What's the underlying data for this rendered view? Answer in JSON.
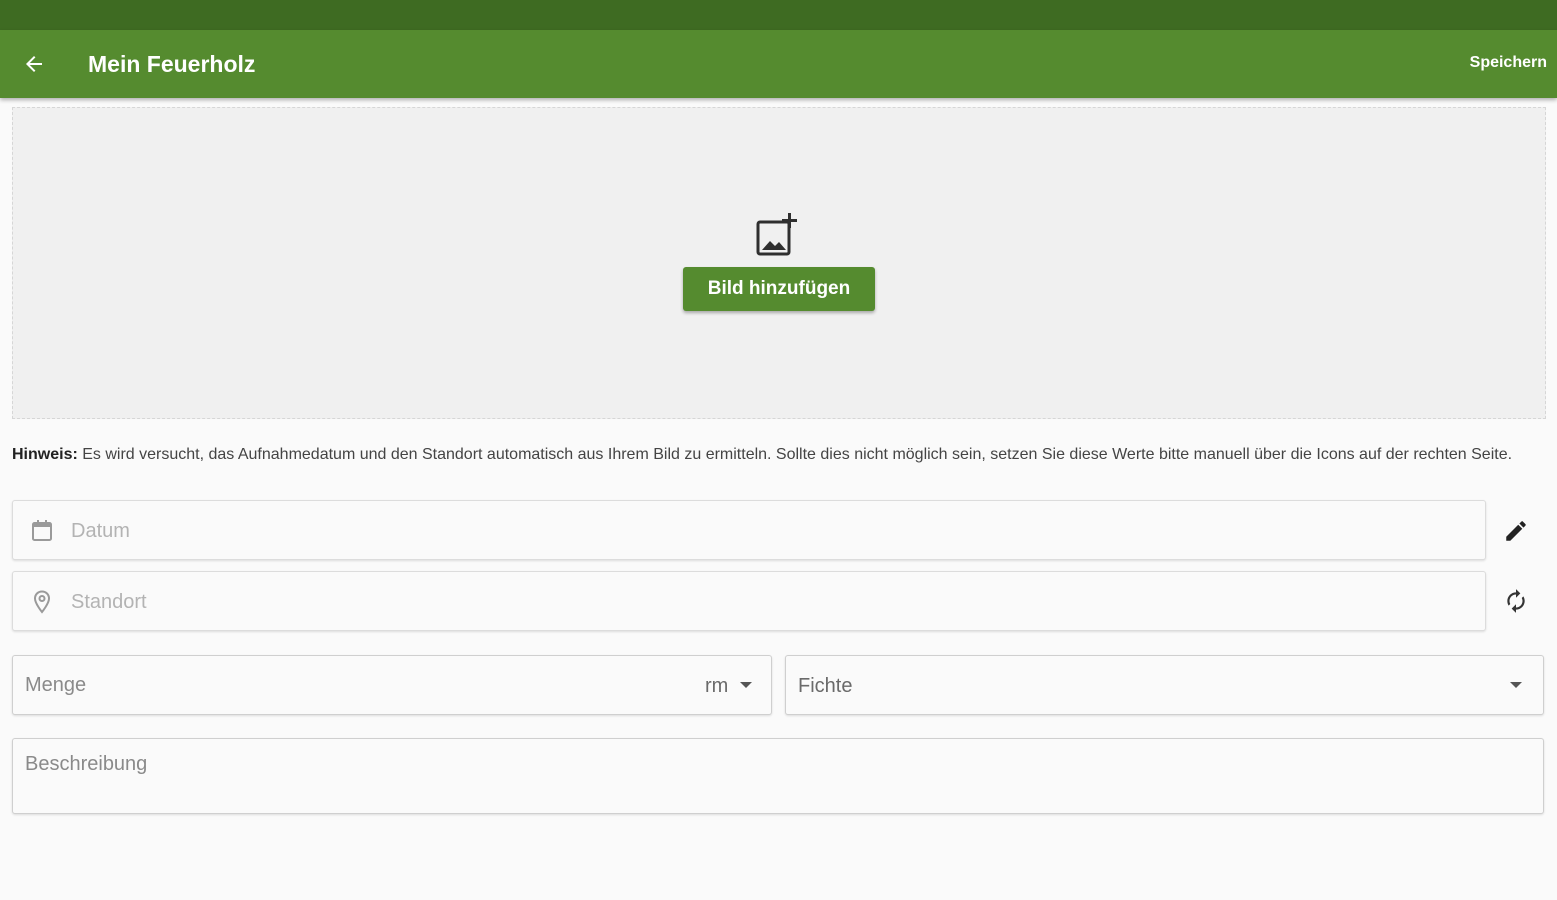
{
  "header": {
    "title": "Mein Feuerholz",
    "save_label": "Speichern"
  },
  "image_upload": {
    "button_label": "Bild hinzufügen",
    "icon": "add-photo-icon"
  },
  "hint": {
    "label": "Hinweis:",
    "text": " Es wird versucht, das Aufnahmedatum und den Standort automatisch aus Ihrem Bild zu ermitteln. Sollte dies nicht möglich sein, setzen Sie diese Werte bitte manuell über die Icons auf der rechten Seite."
  },
  "fields": {
    "date_placeholder": "Datum",
    "location_placeholder": "Standort",
    "amount_label": "Menge",
    "unit_value": "rm",
    "wood_type_value": "Fichte",
    "description_label": "Beschreibung"
  },
  "colors": {
    "primary": "#558b2f",
    "primary_dark": "#3e6b22"
  }
}
